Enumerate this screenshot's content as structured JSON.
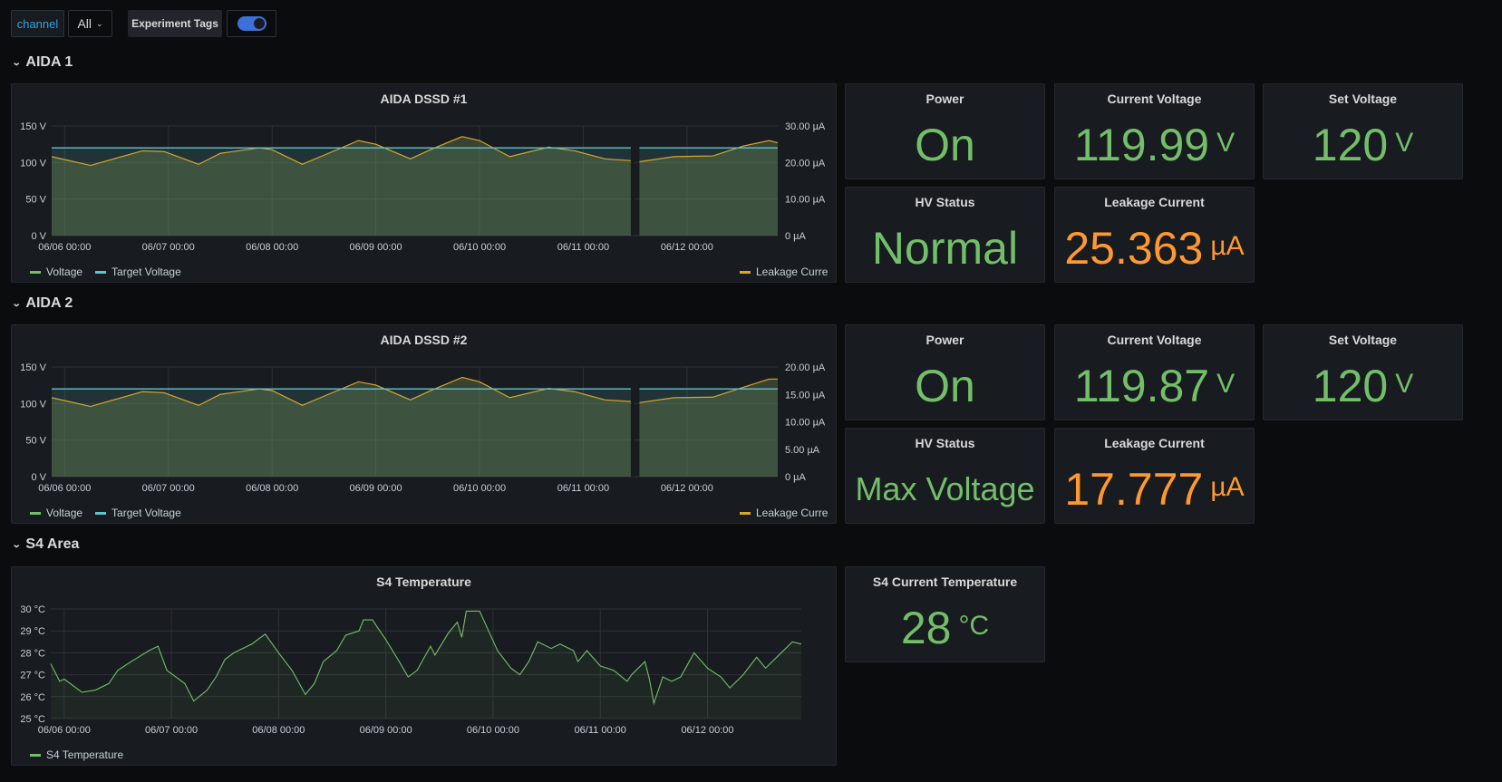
{
  "toolbar": {
    "variable_label": "channel",
    "variable_value": "All",
    "tags_label": "Experiment Tags",
    "tags_toggle_on": true
  },
  "colors": {
    "green": "#73bf69",
    "orange": "#ff9830",
    "leakage": "#d6a72d",
    "target": "#5fc4cf",
    "accent": "#33a2e5",
    "toggle": "#3d71d9"
  },
  "rows": [
    {
      "title": "AIDA 1",
      "chart": {
        "title": "AIDA DSSD #1",
        "left_ticks": [
          "0 V",
          "50 V",
          "100 V",
          "150 V"
        ],
        "right_ticks": [
          "0 µA",
          "10.00 µA",
          "20.00 µA",
          "30.00 µA"
        ],
        "right_max": 30,
        "legend": [
          "Voltage",
          "Target Voltage",
          "Leakage Current"
        ]
      },
      "stats": [
        {
          "title": "Power",
          "value": "On",
          "unit": "",
          "color": "green"
        },
        {
          "title": "Current Voltage",
          "value": "119.99",
          "unit": "V",
          "color": "green"
        },
        {
          "title": "Set Voltage",
          "value": "120",
          "unit": "V",
          "color": "green"
        },
        {
          "title": "HV Status",
          "value": "Normal",
          "unit": "",
          "color": "green"
        },
        {
          "title": "Leakage Current",
          "value": "25.363",
          "unit": "µA",
          "color": "orange"
        }
      ]
    },
    {
      "title": "AIDA 2",
      "chart": {
        "title": "AIDA DSSD #2",
        "left_ticks": [
          "0 V",
          "50 V",
          "100 V",
          "150 V"
        ],
        "right_ticks": [
          "0 µA",
          "5.00 µA",
          "10.00 µA",
          "15.00 µA",
          "20.00 µA"
        ],
        "right_max": 20,
        "legend": [
          "Voltage",
          "Target Voltage",
          "Leakage Current"
        ]
      },
      "stats": [
        {
          "title": "Power",
          "value": "On",
          "unit": "",
          "color": "green"
        },
        {
          "title": "Current Voltage",
          "value": "119.87",
          "unit": "V",
          "color": "green"
        },
        {
          "title": "Set Voltage",
          "value": "120",
          "unit": "V",
          "color": "green"
        },
        {
          "title": "HV Status",
          "value": "Max Voltage",
          "unit": "",
          "color": "green"
        },
        {
          "title": "Leakage Current",
          "value": "17.777",
          "unit": "µA",
          "color": "orange"
        }
      ]
    },
    {
      "title": "S4 Area",
      "chart": {
        "title": "S4 Temperature",
        "left_ticks": [
          "25 °C",
          "26 °C",
          "27 °C",
          "28 °C",
          "29 °C",
          "30 °C"
        ],
        "legend": [
          "S4 Temperature"
        ]
      },
      "stats": [
        {
          "title": "S4 Current Temperature",
          "value": "28",
          "unit": "°C",
          "color": "green"
        }
      ]
    }
  ],
  "chart_data": [
    {
      "type": "line",
      "title": "AIDA DSSD #1",
      "x_ticks": [
        "06/06 00:00",
        "06/07 00:00",
        "06/08 00:00",
        "06/09 00:00",
        "06/10 00:00",
        "06/11 00:00",
        "06/12 00:00"
      ],
      "xlim": [
        "06/05 21:00",
        "06/12 21:00"
      ],
      "ylim_left": [
        0,
        150
      ],
      "ylim_right": [
        0,
        30
      ],
      "grid": true,
      "legend": "bottom",
      "series": [
        {
          "name": "Voltage",
          "axis": "left",
          "values": [
            [
              "06/05 21:00",
              120
            ],
            [
              "06/11 11:00",
              120
            ],
            [
              "06/11 12:00",
              null
            ],
            [
              "06/11 13:00",
              120
            ],
            [
              "06/12 21:00",
              120
            ]
          ]
        },
        {
          "name": "Target Voltage",
          "axis": "left",
          "values": [
            [
              "06/05 21:00",
              120
            ],
            [
              "06/11 11:00",
              120
            ],
            [
              "06/11 12:00",
              null
            ],
            [
              "06/11 13:00",
              120
            ],
            [
              "06/12 21:00",
              120
            ]
          ]
        },
        {
          "name": "Leakage Current",
          "axis": "right",
          "values": [
            [
              "06/05 21:00",
              21.6
            ],
            [
              "06/06 06:00",
              19.2
            ],
            [
              "06/06 18:00",
              23.2
            ],
            [
              "06/06 23:00",
              23.0
            ],
            [
              "06/07 07:00",
              19.5
            ],
            [
              "06/07 12:00",
              22.5
            ],
            [
              "06/07 21:00",
              24.0
            ],
            [
              "06/08 00:00",
              23.5
            ],
            [
              "06/08 07:00",
              19.5
            ],
            [
              "06/08 13:00",
              22.5
            ],
            [
              "06/08 20:00",
              26.0
            ],
            [
              "06/09 00:00",
              25.0
            ],
            [
              "06/09 08:00",
              21.0
            ],
            [
              "06/09 13:00",
              23.7
            ],
            [
              "06/09 20:00",
              27.1
            ],
            [
              "06/10 00:00",
              26.0
            ],
            [
              "06/10 07:00",
              21.6
            ],
            [
              "06/10 16:00",
              24.2
            ],
            [
              "06/10 22:00",
              23.2
            ],
            [
              "06/11 05:00",
              21.0
            ],
            [
              "06/11 11:00",
              20.5
            ],
            [
              "06/11 12:00",
              null
            ],
            [
              "06/11 13:00",
              20.2
            ],
            [
              "06/11 21:00",
              21.6
            ],
            [
              "06/12 06:00",
              21.8
            ],
            [
              "06/12 13:00",
              24.5
            ],
            [
              "06/12 19:00",
              26.0
            ],
            [
              "06/12 21:00",
              25.4
            ]
          ]
        }
      ]
    },
    {
      "type": "line",
      "title": "AIDA DSSD #2",
      "x_ticks": [
        "06/06 00:00",
        "06/07 00:00",
        "06/08 00:00",
        "06/09 00:00",
        "06/10 00:00",
        "06/11 00:00",
        "06/12 00:00"
      ],
      "xlim": [
        "06/05 21:00",
        "06/12 21:00"
      ],
      "ylim_left": [
        0,
        150
      ],
      "ylim_right": [
        0,
        20
      ],
      "grid": true,
      "legend": "bottom",
      "series": [
        {
          "name": "Voltage",
          "axis": "left",
          "values": [
            [
              "06/05 21:00",
              120
            ],
            [
              "06/11 11:00",
              120
            ],
            [
              "06/11 12:00",
              null
            ],
            [
              "06/11 13:00",
              120
            ],
            [
              "06/12 21:00",
              120
            ]
          ]
        },
        {
          "name": "Target Voltage",
          "axis": "left",
          "values": [
            [
              "06/05 21:00",
              120
            ],
            [
              "06/11 11:00",
              120
            ],
            [
              "06/11 12:00",
              null
            ],
            [
              "06/11 13:00",
              120
            ],
            [
              "06/12 21:00",
              120
            ]
          ]
        },
        {
          "name": "Leakage Current",
          "axis": "right",
          "values": [
            [
              "06/05 21:00",
              14.4
            ],
            [
              "06/06 06:00",
              12.8
            ],
            [
              "06/06 18:00",
              15.5
            ],
            [
              "06/06 23:00",
              15.3
            ],
            [
              "06/07 07:00",
              13.0
            ],
            [
              "06/07 12:00",
              15.0
            ],
            [
              "06/07 21:00",
              16.0
            ],
            [
              "06/08 00:00",
              15.7
            ],
            [
              "06/08 07:00",
              13.0
            ],
            [
              "06/08 13:00",
              15.0
            ],
            [
              "06/08 20:00",
              17.3
            ],
            [
              "06/09 00:00",
              16.7
            ],
            [
              "06/09 08:00",
              14.0
            ],
            [
              "06/09 13:00",
              15.8
            ],
            [
              "06/09 20:00",
              18.1
            ],
            [
              "06/10 00:00",
              17.3
            ],
            [
              "06/10 07:00",
              14.4
            ],
            [
              "06/10 16:00",
              16.1
            ],
            [
              "06/10 22:00",
              15.5
            ],
            [
              "06/11 05:00",
              14.0
            ],
            [
              "06/11 11:00",
              13.7
            ],
            [
              "06/11 12:00",
              null
            ],
            [
              "06/11 13:00",
              13.5
            ],
            [
              "06/11 21:00",
              14.4
            ],
            [
              "06/12 06:00",
              14.5
            ],
            [
              "06/12 13:00",
              16.3
            ],
            [
              "06/12 19:00",
              17.8
            ],
            [
              "06/12 21:00",
              17.8
            ]
          ]
        }
      ]
    },
    {
      "type": "area",
      "title": "S4 Temperature",
      "x_ticks": [
        "06/06 00:00",
        "06/07 00:00",
        "06/08 00:00",
        "06/09 00:00",
        "06/10 00:00",
        "06/11 00:00",
        "06/12 00:00"
      ],
      "xlim": [
        "06/05 21:00",
        "06/12 21:00"
      ],
      "ylim": [
        25,
        30
      ],
      "grid": true,
      "legend": "bottom",
      "series": [
        {
          "name": "S4 Temperature",
          "values": [
            [
              "06/05 21:00",
              27.5
            ],
            [
              "06/05 22:00",
              27.1
            ],
            [
              "06/05 23:00",
              26.7
            ],
            [
              "06/06 00:00",
              26.8
            ],
            [
              "06/06 04:00",
              26.2
            ],
            [
              "06/06 07:00",
              26.3
            ],
            [
              "06/06 10:00",
              26.6
            ],
            [
              "06/06 12:00",
              27.2
            ],
            [
              "06/06 15:00",
              27.6
            ],
            [
              "06/06 19:00",
              28.1
            ],
            [
              "06/06 21:00",
              28.3
            ],
            [
              "06/06 23:00",
              27.2
            ],
            [
              "06/07 03:00",
              26.6
            ],
            [
              "06/07 05:00",
              25.8
            ],
            [
              "06/07 08:00",
              26.3
            ],
            [
              "06/07 10:00",
              26.9
            ],
            [
              "06/07 12:00",
              27.7
            ],
            [
              "06/07 14:00",
              28.0
            ],
            [
              "06/07 18:00",
              28.4
            ],
            [
              "06/07 21:00",
              28.85
            ],
            [
              "06/08 00:00",
              28.0
            ],
            [
              "06/08 03:00",
              27.2
            ],
            [
              "06/08 06:00",
              26.1
            ],
            [
              "06/08 08:00",
              26.6
            ],
            [
              "06/08 10:00",
              27.6
            ],
            [
              "06/08 13:00",
              28.1
            ],
            [
              "06/08 15:00",
              28.8
            ],
            [
              "06/08 18:00",
              29.0
            ],
            [
              "06/08 19:00",
              29.5
            ],
            [
              "06/08 21:00",
              29.5
            ],
            [
              "06/09 00:00",
              28.6
            ],
            [
              "06/09 03:00",
              27.6
            ],
            [
              "06/09 05:00",
              26.9
            ],
            [
              "06/09 07:00",
              27.2
            ],
            [
              "06/09 10:00",
              28.3
            ],
            [
              "06/09 11:00",
              27.9
            ],
            [
              "06/09 14:00",
              28.9
            ],
            [
              "06/09 16:00",
              29.4
            ],
            [
              "06/09 17:00",
              28.7
            ],
            [
              "06/09 18:00",
              29.9
            ],
            [
              "06/09 21:00",
              29.9
            ],
            [
              "06/09 23:00",
              29.0
            ],
            [
              "06/10 01:00",
              28.1
            ],
            [
              "06/10 04:00",
              27.3
            ],
            [
              "06/10 06:00",
              27.0
            ],
            [
              "06/10 08:00",
              27.6
            ],
            [
              "06/10 10:00",
              28.5
            ],
            [
              "06/10 13:00",
              28.2
            ],
            [
              "06/10 15:00",
              28.4
            ],
            [
              "06/10 18:00",
              28.1
            ],
            [
              "06/10 19:00",
              27.6
            ],
            [
              "06/10 21:00",
              28.1
            ],
            [
              "06/11 00:00",
              27.4
            ],
            [
              "06/11 03:00",
              27.2
            ],
            [
              "06/11 06:00",
              26.7
            ],
            [
              "06/11 07:00",
              27.0
            ],
            [
              "06/11 10:00",
              27.6
            ],
            [
              "06/11 11:00",
              26.8
            ],
            [
              "06/11 12:00",
              25.7
            ],
            [
              "06/11 14:00",
              26.9
            ],
            [
              "06/11 16:00",
              26.7
            ],
            [
              "06/11 18:00",
              26.9
            ],
            [
              "06/11 21:00",
              28.0
            ],
            [
              "06/12 00:00",
              27.3
            ],
            [
              "06/12 03:00",
              26.9
            ],
            [
              "06/12 05:00",
              26.4
            ],
            [
              "06/12 08:00",
              27.0
            ],
            [
              "06/12 11:00",
              27.8
            ],
            [
              "06/12 13:00",
              27.3
            ],
            [
              "06/12 16:00",
              27.9
            ],
            [
              "06/12 19:00",
              28.5
            ],
            [
              "06/12 21:00",
              28.4
            ]
          ]
        }
      ]
    }
  ]
}
